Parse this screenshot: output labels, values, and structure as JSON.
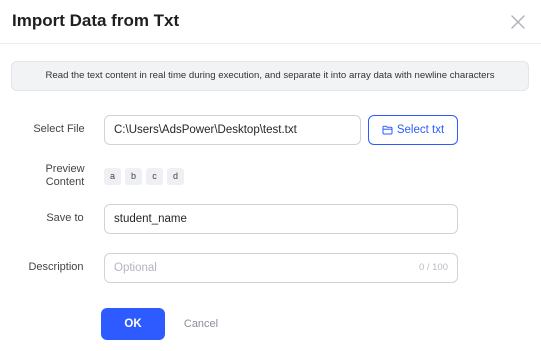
{
  "dialog": {
    "title": "Import Data from Txt",
    "close_icon": "close-icon"
  },
  "notice": {
    "text": "Read the text content in real time during execution, and separate it into array data with newline characters"
  },
  "form": {
    "select_file": {
      "label": "Select File",
      "value": "C:\\Users\\AdsPower\\Desktop\\test.txt",
      "button_label": "Select txt",
      "button_icon": "folder-icon"
    },
    "preview": {
      "label_line1": "Preview",
      "label_line2": "Content",
      "items": [
        "a",
        "b",
        "c",
        "d"
      ]
    },
    "save_to": {
      "label": "Save to",
      "value": "student_name"
    },
    "description": {
      "label": "Description",
      "placeholder": "Optional",
      "counter": "0 / 100"
    }
  },
  "actions": {
    "ok_label": "OK",
    "cancel_label": "Cancel"
  },
  "colors": {
    "primary": "#2d5bff",
    "notice_bg": "#f2f3f5",
    "border": "#cfd3da"
  }
}
